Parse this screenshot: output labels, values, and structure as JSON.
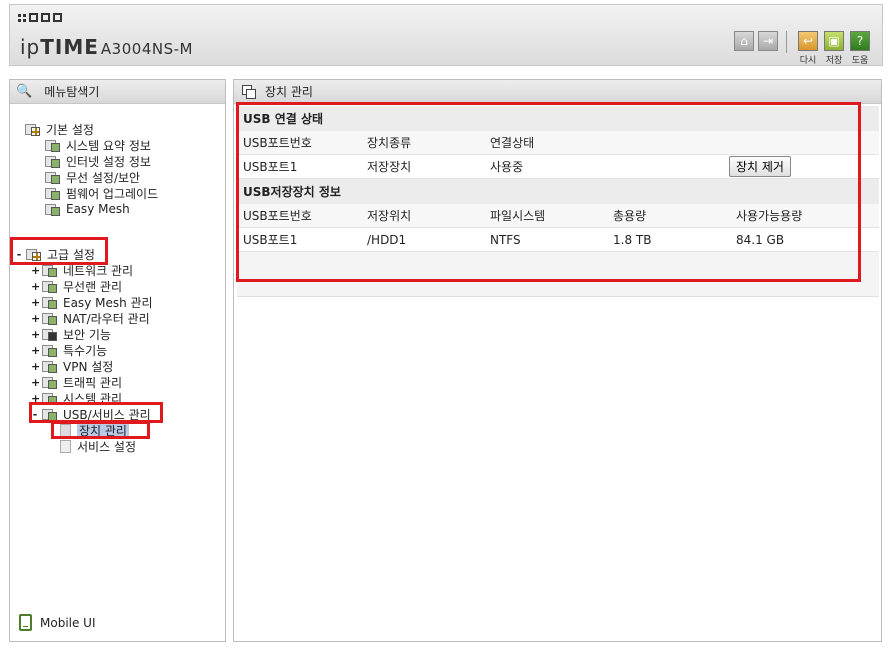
{
  "header": {
    "brand": "ipTIME",
    "brand_light": "ip",
    "brand_bold": "TIME",
    "model": "A3004NS-M",
    "icons": [
      "home-icon",
      "logout-icon"
    ],
    "buttons": [
      {
        "label": "다시",
        "icon": "undo-icon",
        "color": "#d9962b"
      },
      {
        "label": "저장",
        "icon": "save-icon",
        "color": "#8cb030"
      },
      {
        "label": "도움",
        "icon": "help-icon",
        "color": "#2f7d1e"
      }
    ]
  },
  "sidebar": {
    "title": "메뉴탐색기",
    "groups": [
      {
        "label": "기본 설정",
        "items": [
          "시스템 요약 정보",
          "인터넷 설정 정보",
          "무선 설정/보안",
          "펌웨어 업그레이드",
          "Easy Mesh"
        ]
      },
      {
        "label": "고급 설정",
        "items": [
          "네트워크 관리",
          "무선랜 관리",
          "Easy Mesh 관리",
          "NAT/라우터 관리",
          "보안 기능",
          "특수기능",
          "VPN 설정",
          "트래픽 관리",
          "시스템 관리",
          "USB/서비스 관리"
        ]
      }
    ],
    "usb_children": [
      "장치 관리",
      "서비스 설정"
    ],
    "expanders": {
      "minus": "-",
      "plus": "+"
    },
    "mobile_label": "Mobile UI"
  },
  "main": {
    "title": "장치 관리",
    "usb_status": {
      "title": "USB 연결 상태",
      "headers": [
        "USB포트번호",
        "장치종류",
        "연결상태"
      ],
      "rows": [
        [
          "USB포트1",
          "저장장치",
          "사용중"
        ]
      ],
      "remove_button": "장치 제거"
    },
    "storage_info": {
      "title": "USB저장장치 정보",
      "headers": [
        "USB포트번호",
        "저장위치",
        "파일시스템",
        "총용량",
        "사용가능용량"
      ],
      "rows": [
        [
          "USB포트1",
          "/HDD1",
          "NTFS",
          "1.8 TB",
          "84.1 GB"
        ]
      ]
    }
  },
  "highlight_color": "#e0191f"
}
